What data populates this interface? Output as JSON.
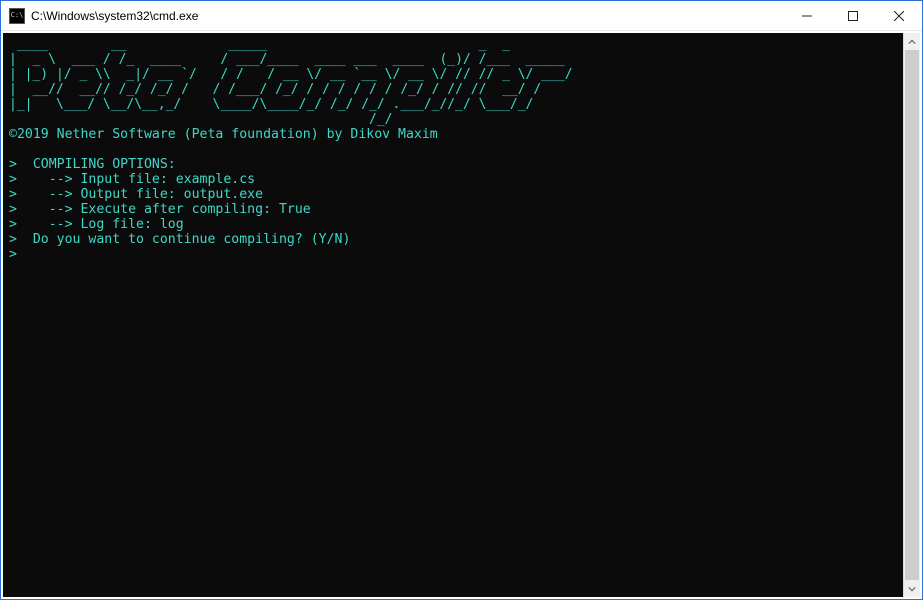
{
  "window": {
    "title": "C:\\Windows\\system32\\cmd.exe",
    "icon_label": "C:\\"
  },
  "terminal": {
    "ascii_art": " ____        __             _____                           _  _\n|  _ \\  ___ / /_  ____     / ___/____  ____ ___  ____  (_)/ /___  _____\n| |_) |/ _ \\\\  _|/ __ `/   / /   / __ \\/ __ `__ \\/ __ \\/ // // _ \\/ ___/\n|  __//  __// /_/ /_/ /   / /___/ /_/ / / / / / / /_/ / // //  __/ /\n|_|   \\___/ \\__/\\__,_/    \\____/\\____/_/ /_/ /_/ .___/_//_/ \\___/_/\n                                              /_/",
    "copyright": "©2019 Nether Software (Peta foundation) by Dikov Maxim",
    "lines": [
      "",
      ">  COMPILING OPTIONS:",
      ">    --> Input file: example.cs",
      ">    --> Output file: output.exe",
      ">    --> Execute after compiling: True",
      ">    --> Log file: log",
      ">  Do you want to continue compiling? (Y/N)",
      ">"
    ]
  }
}
